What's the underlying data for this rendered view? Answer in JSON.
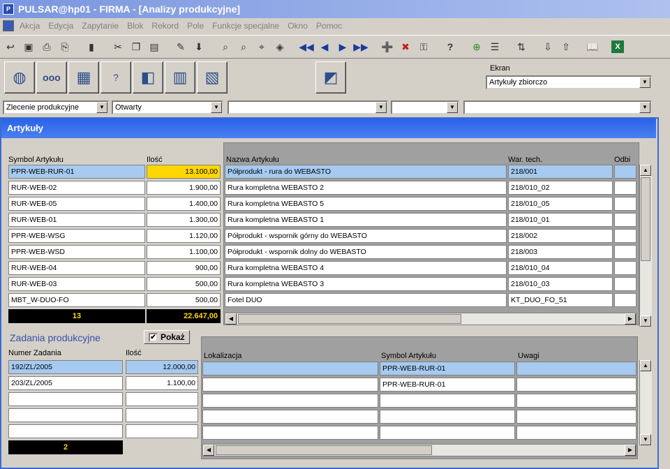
{
  "window": {
    "title": "PULSAR@hp01 - FIRMA - [Analizy produkcyjne]"
  },
  "menu": [
    "Akcja",
    "Edycja",
    "Zapytanie",
    "Blok",
    "Rekord",
    "Pole",
    "Funkcje specjalne",
    "Okno",
    "Pomoc"
  ],
  "toolbar_icons": [
    "exit-icon",
    "save-icon",
    "print-preview-icon",
    "print-icon",
    "door-icon",
    "cut-icon",
    "copy-icon",
    "paste-icon",
    "edit-icon",
    "download-icon",
    "query-enter-icon",
    "query-execute-icon",
    "query-count-icon",
    "clear-icon",
    "first-record-icon",
    "prev-record-icon",
    "next-record-icon",
    "last-record-icon",
    "insert-record-icon",
    "delete-record-icon",
    "lock-icon",
    "help-icon",
    "tree-icon",
    "list-icon",
    "sort-icon",
    "import-icon",
    "export-icon",
    "book-icon",
    "excel-icon"
  ],
  "big_buttons": [
    "analysis-icon",
    "links-icon",
    "window-icon",
    "query-icon",
    "box-icon",
    "panel-icon",
    "calculator-icon",
    "box-3d-icon"
  ],
  "ekran": {
    "label": "Ekran",
    "value": "Artykuły zbiorczo"
  },
  "filters": {
    "f1": "Zlecenie produkcyjne",
    "f2": "Otwarty",
    "f3": "",
    "f4": "",
    "f5": ""
  },
  "artykuly": {
    "title": "Artykuły",
    "col_symbol": "Symbol Artykułu",
    "col_ilosc": "Ilość",
    "col_nazwa": "Nazwa Artykułu",
    "col_war": "War. tech.",
    "col_odb": "Odbi",
    "rows": [
      {
        "symbol": "PPR-WEB-RUR-01",
        "ilosc": "13.100,00",
        "nazwa": "Półprodukt - rura do WEBASTO",
        "war": "218/001"
      },
      {
        "symbol": "RUR-WEB-02",
        "ilosc": "1.900,00",
        "nazwa": "Rura kompletna WEBASTO 2",
        "war": "218/010_02"
      },
      {
        "symbol": "RUR-WEB-05",
        "ilosc": "1.400,00",
        "nazwa": "Rura kompletna WEBASTO 5",
        "war": "218/010_05"
      },
      {
        "symbol": "RUR-WEB-01",
        "ilosc": "1.300,00",
        "nazwa": "Rura kompletna WEBASTO 1",
        "war": "218/010_01"
      },
      {
        "symbol": "PPR-WEB-WSG",
        "ilosc": "1.120,00",
        "nazwa": "Półprodukt - wspornik górny do WEBASTO",
        "war": "218/002"
      },
      {
        "symbol": "PPR-WEB-WSD",
        "ilosc": "1.100,00",
        "nazwa": "Półprodukt - wspornik dolny do WEBASTO",
        "war": "218/003"
      },
      {
        "symbol": "RUR-WEB-04",
        "ilosc": "900,00",
        "nazwa": "Rura kompletna WEBASTO 4",
        "war": "218/010_04"
      },
      {
        "symbol": "RUR-WEB-03",
        "ilosc": "500,00",
        "nazwa": "Rura kompletna WEBASTO 3",
        "war": "218/010_03"
      },
      {
        "symbol": "MBT_W-DUO-FO",
        "ilosc": "500,00",
        "nazwa": "Fotel DUO",
        "war": "KT_DUO_FO_51"
      }
    ],
    "total_count": "13",
    "total_sum": "22.647,00"
  },
  "zadania": {
    "title": "Zadania produkcyjne",
    "pokaz_label": "Pokaż",
    "pokaz_checked": "✔",
    "col_numer": "Numer Zadania",
    "col_ilosc": "Ilość",
    "rows": [
      {
        "numer": "192/ZL/2005",
        "ilosc": "12.000,00"
      },
      {
        "numer": "203/ZL/2005",
        "ilosc": "1.100,00"
      }
    ],
    "total_count": "2"
  },
  "lokalizacje": {
    "col_lok": "Lokalizacja",
    "col_symbol": "Symbol Artykułu",
    "col_uwagi": "Uwagi",
    "rows": [
      {
        "lok": "",
        "symbol": "PPR-WEB-RUR-01",
        "uwagi": ""
      },
      {
        "lok": "",
        "symbol": "PPR-WEB-RUR-01",
        "uwagi": ""
      }
    ]
  }
}
